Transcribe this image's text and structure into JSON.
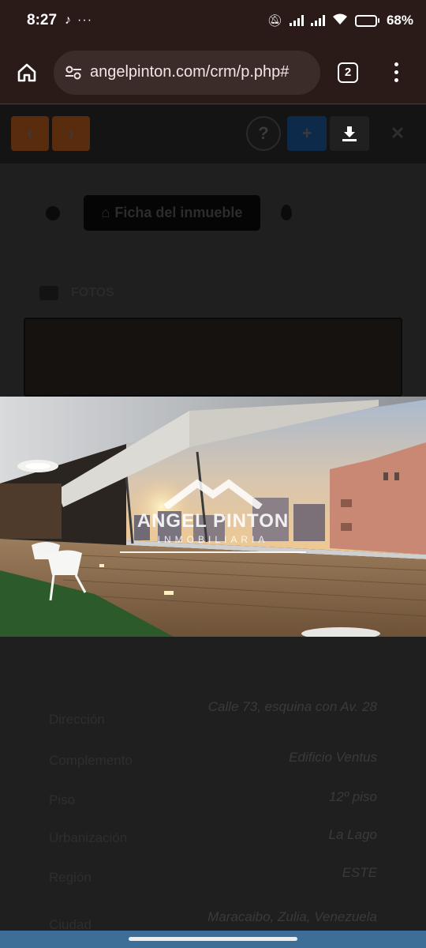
{
  "status": {
    "time": "8:27",
    "battery_pct": "68%",
    "battery_level": 0.68
  },
  "browser": {
    "url": "angelpinton.com/crm/p.php#",
    "tab_count": "2"
  },
  "page": {
    "ficha_label": "Ficha del inmueble",
    "fotos_label": "FOTOS",
    "details": [
      {
        "key": "Dirección",
        "value": "Calle 73, esquina con Av. 28"
      },
      {
        "key": "Complemento",
        "value": "Edificio Ventus"
      },
      {
        "key": "Piso",
        "value": "12º piso"
      },
      {
        "key": "Urbanización",
        "value": "La Lago"
      },
      {
        "key": "Región",
        "value": "ESTE"
      },
      {
        "key": "Ciudad",
        "value": "Maracaibo, Zulia, Venezuela"
      }
    ]
  },
  "photo": {
    "brand_name": "ANGEL PINTON",
    "brand_sub": "INMOBILIARIA"
  },
  "colors": {
    "chrome_bg": "#2a1a18",
    "url_pill": "#3c2c29",
    "nav_bar": "#3c6e98"
  }
}
